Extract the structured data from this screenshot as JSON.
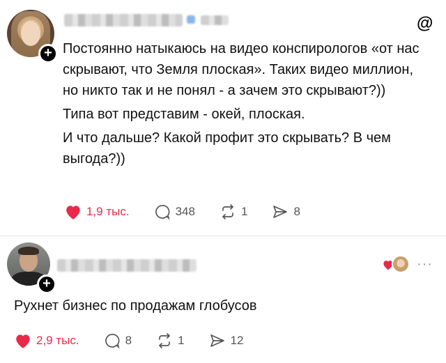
{
  "post": {
    "author_blurred": true,
    "lines": [
      "Постоянно натыкаюсь на видео конспирологов «от нас скрывают, что Земля плоская». Таких видео миллион, но никто так и не понял - а зачем это скрывают?))",
      "Типа вот представим - окей, плоская.",
      "И что дальше? Какой профит это скрывать? В чем выгода?))"
    ],
    "likes": "1,9 тыс.",
    "comments": "348",
    "reposts": "1",
    "shares": "8"
  },
  "reply": {
    "author_blurred": true,
    "text": "Рухнет бизнес по продажам глобусов",
    "likes": "2,9 тыс.",
    "comments": "8",
    "reposts": "1",
    "shares": "12",
    "more": "···"
  },
  "colors": {
    "like": "#e8294a",
    "muted": "#555555",
    "text": "#111111"
  },
  "icons": [
    "plus-icon",
    "threads-logo-icon",
    "heart-icon",
    "comment-icon",
    "repost-icon",
    "share-icon",
    "more-icon"
  ]
}
